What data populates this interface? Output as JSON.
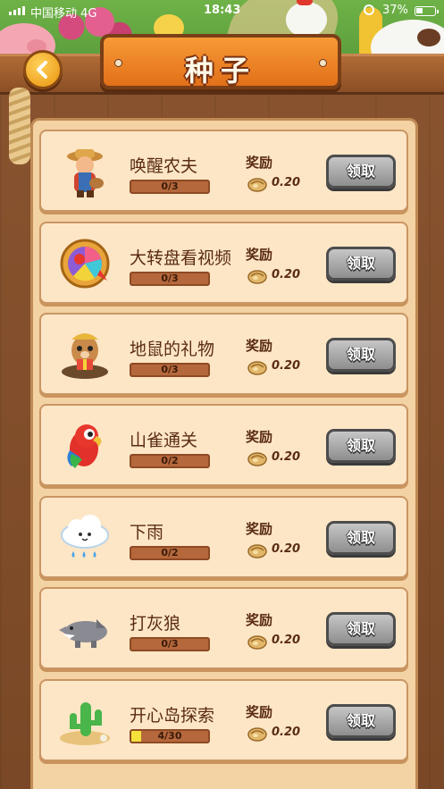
{
  "status_bar": {
    "carrier": "中国移动 4G",
    "time": "18:43",
    "battery_percent": "37%",
    "battery_level": 0.37
  },
  "header": {
    "title": "种子",
    "back_icon": "back-arrow-icon"
  },
  "tasks": [
    {
      "name": "唤醒农夫",
      "progress_text": "0/3",
      "progress": 0,
      "reward_label": "奖励",
      "reward_value": "0.20",
      "icon": "farmer-icon",
      "button": "领取"
    },
    {
      "name": "大转盘看视频",
      "progress_text": "0/3",
      "progress": 0,
      "reward_label": "奖励",
      "reward_value": "0.20",
      "icon": "wheel-icon",
      "button": "领取"
    },
    {
      "name": "地鼠的礼物",
      "progress_text": "0/3",
      "progress": 0,
      "reward_label": "奖励",
      "reward_value": "0.20",
      "icon": "gopher-icon",
      "button": "领取"
    },
    {
      "name": "山雀通关",
      "progress_text": "0/2",
      "progress": 0,
      "reward_label": "奖励",
      "reward_value": "0.20",
      "icon": "parrot-icon",
      "button": "领取"
    },
    {
      "name": "下雨",
      "progress_text": "0/2",
      "progress": 0,
      "reward_label": "奖励",
      "reward_value": "0.20",
      "icon": "rain-cloud-icon",
      "button": "领取"
    },
    {
      "name": "打灰狼",
      "progress_text": "0/3",
      "progress": 0,
      "reward_label": "奖励",
      "reward_value": "0.20",
      "icon": "wolf-icon",
      "button": "领取"
    },
    {
      "name": "开心岛探索",
      "progress_text": "4/30",
      "progress": 0.133,
      "reward_label": "奖励",
      "reward_value": "0.20",
      "icon": "cactus-island-icon",
      "button": "领取"
    }
  ],
  "colors": {
    "button_grey": "#9a9a9a",
    "progress_fill": "#f5e23a",
    "banner_orange": "#f08a2a"
  }
}
